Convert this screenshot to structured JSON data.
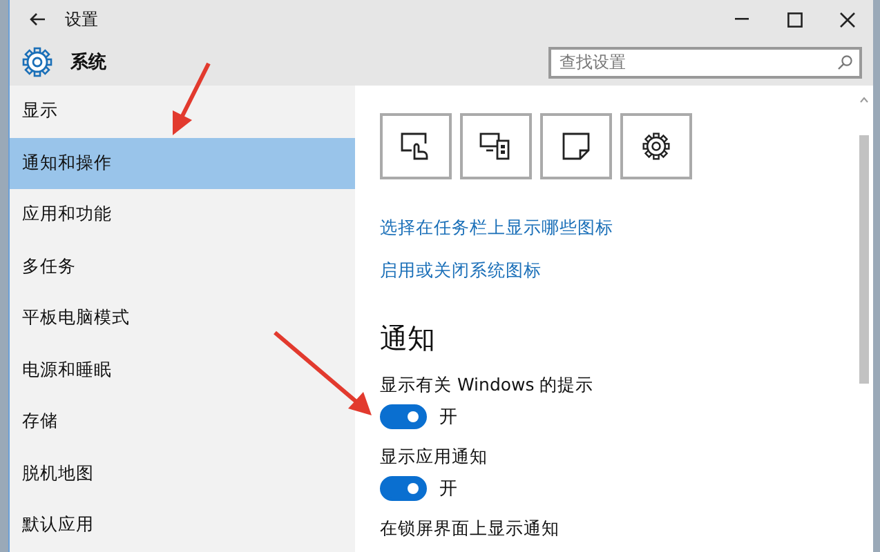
{
  "window": {
    "title": "设置"
  },
  "header": {
    "title": "系统"
  },
  "search": {
    "placeholder": "查找设置"
  },
  "sidebar": {
    "items": [
      {
        "label": "显示",
        "selected": false
      },
      {
        "label": "通知和操作",
        "selected": true
      },
      {
        "label": "应用和功能",
        "selected": false
      },
      {
        "label": "多任务",
        "selected": false
      },
      {
        "label": "平板电脑模式",
        "selected": false
      },
      {
        "label": "电源和睡眠",
        "selected": false
      },
      {
        "label": "存储",
        "selected": false
      },
      {
        "label": "脱机地图",
        "selected": false
      },
      {
        "label": "默认应用",
        "selected": false
      }
    ]
  },
  "quick_actions": [
    {
      "kind": "touch"
    },
    {
      "kind": "devices"
    },
    {
      "kind": "note"
    },
    {
      "kind": "settings"
    }
  ],
  "links": [
    "选择在任务栏上显示哪些图标",
    "启用或关闭系统图标"
  ],
  "section": {
    "heading": "通知",
    "settings": [
      {
        "label": "显示有关 Windows 的提示",
        "on": true,
        "state_text": "开"
      },
      {
        "label": "显示应用通知",
        "on": true,
        "state_text": "开"
      },
      {
        "label": "在锁屏界面上显示通知"
      }
    ]
  }
}
